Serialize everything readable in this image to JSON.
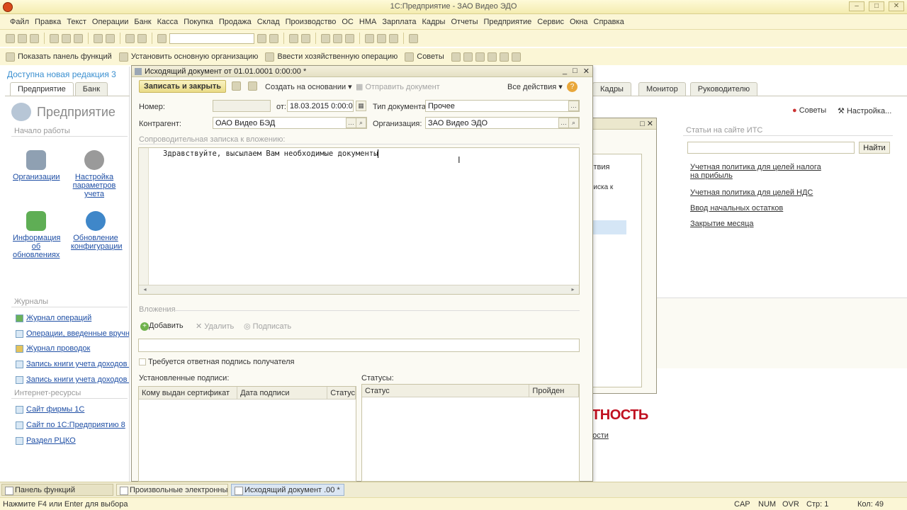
{
  "window": {
    "title": "1С:Предприятие - ЗАО Видео ЭДО"
  },
  "menu": [
    "Файл",
    "Правка",
    "Текст",
    "Операции",
    "Банк",
    "Касса",
    "Покупка",
    "Продажа",
    "Склад",
    "Производство",
    "ОС",
    "НМА",
    "Зарплата",
    "Кадры",
    "Отчеты",
    "Предприятие",
    "Сервис",
    "Окна",
    "Справка"
  ],
  "toolbar2": {
    "show_panel": "Показать панель функций",
    "set_org": "Установить основную организацию",
    "enter_op": "Ввести хозяйственную операцию",
    "tips": "Советы"
  },
  "left": {
    "new_revision": "Доступна новая редакция 3",
    "tabs": [
      "Предприятие",
      "Банк"
    ],
    "big_title": "Предприятие",
    "start_section": "Начало работы",
    "icon_items": [
      {
        "label": "Организации",
        "color": "#8fa0b2"
      },
      {
        "label": "Настройка параметров учета",
        "color": "#9a9a9a"
      },
      {
        "label": "Информация об обновлениях",
        "color": "#5fae55"
      },
      {
        "label": "Обновление конфигурации",
        "color": "#3f87c9"
      }
    ],
    "journals_section": "Журналы",
    "journals": [
      "Журнал операций",
      "Операции, введенные вручн",
      "Журнал проводок",
      "Запись книги учета доходов и",
      "Запись книги учета доходов и"
    ],
    "internet_section": "Интернет-ресурсы",
    "internet": [
      "Сайт фирмы 1С",
      "Сайт по 1С:Предприятию 8",
      "Раздел РЦКО"
    ]
  },
  "main_tabs": [
    "Кадры",
    "Монитор",
    "Руководителю"
  ],
  "main_links": {
    "tips": "Советы",
    "settings": "Настройка..."
  },
  "its": {
    "section": "Статьи на сайте ИТС",
    "find_button": "Найти",
    "links": [
      "Учетная политика для целей налога на прибыль",
      "Учетная политика для целей НДС",
      "Ввод начальных остатков",
      "Закрытие месяца"
    ]
  },
  "background": {
    "red_text": "ОТНОСТЬ",
    "link": "ности"
  },
  "bg_window": {
    "actions": "ствия",
    "col": "писка к"
  },
  "dialog": {
    "title": "Исходящий документ  от 01.01.0001 0:00:00 *",
    "save_close": "Записать и закрыть",
    "create_based": "Создать на основании",
    "send_doc": "Отправить документ",
    "all_actions": "Все действия",
    "number_label": "Номер:",
    "number_value": "",
    "from_label": "от:",
    "date_value": "18.03.2015  0:00:00",
    "doctype_label": "Тип документа:",
    "doctype_value": "Прочее",
    "counterparty_label": "Контрагент:",
    "counterparty_value": "ОАО Видео БЭД",
    "org_label": "Организация:",
    "org_value": "ЗАО Видео ЭДО",
    "note_label": "Сопроводительная записка к вложению:",
    "note_text": "Здравствуйте, высылаем Вам необходимые документы",
    "attach_label": "Вложения",
    "add_btn": "Добавить",
    "delete_btn": "Удалить",
    "sign_btn": "Подписать",
    "reply_required": "Требуется ответная подпись получателя",
    "signatures_label": "Установленные подписи:",
    "sig_cols": [
      "Кому выдан сертификат",
      "Дата подписи",
      "Статус"
    ],
    "statuses_label": "Статусы:",
    "status_cols": [
      "Статус",
      "Пройден"
    ]
  },
  "taskbar": [
    "Панель функций",
    "Произвольные электронны...",
    "Исходящий документ  .00 *"
  ],
  "status": {
    "hint": "Нажмите F4 или Enter для выбора",
    "cap": "CAP",
    "num": "NUM",
    "ovr": "OVR",
    "line": "Стр: 1",
    "col": "Кол: 49"
  }
}
